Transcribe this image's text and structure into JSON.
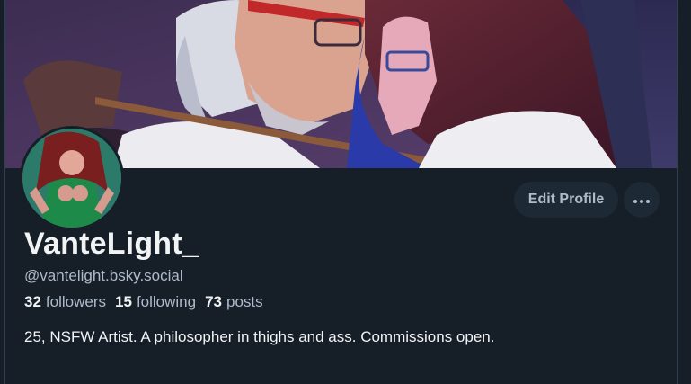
{
  "profile": {
    "display_name": "VanteLight_",
    "handle": "@vantelight.bsky.social",
    "bio": "25, NSFW Artist. A philosopher in thighs and ass. Commissions open."
  },
  "stats": {
    "followers_count": "32",
    "followers_label": "followers",
    "following_count": "15",
    "following_label": "following",
    "posts_count": "73",
    "posts_label": "posts"
  },
  "actions": {
    "edit_profile_label": "Edit Profile",
    "more_icon": "ellipsis-icon"
  },
  "colors": {
    "background": "#161e27",
    "button_bg": "#1e2936",
    "text_primary": "#f1f3f5",
    "text_secondary": "#aebbc9"
  }
}
